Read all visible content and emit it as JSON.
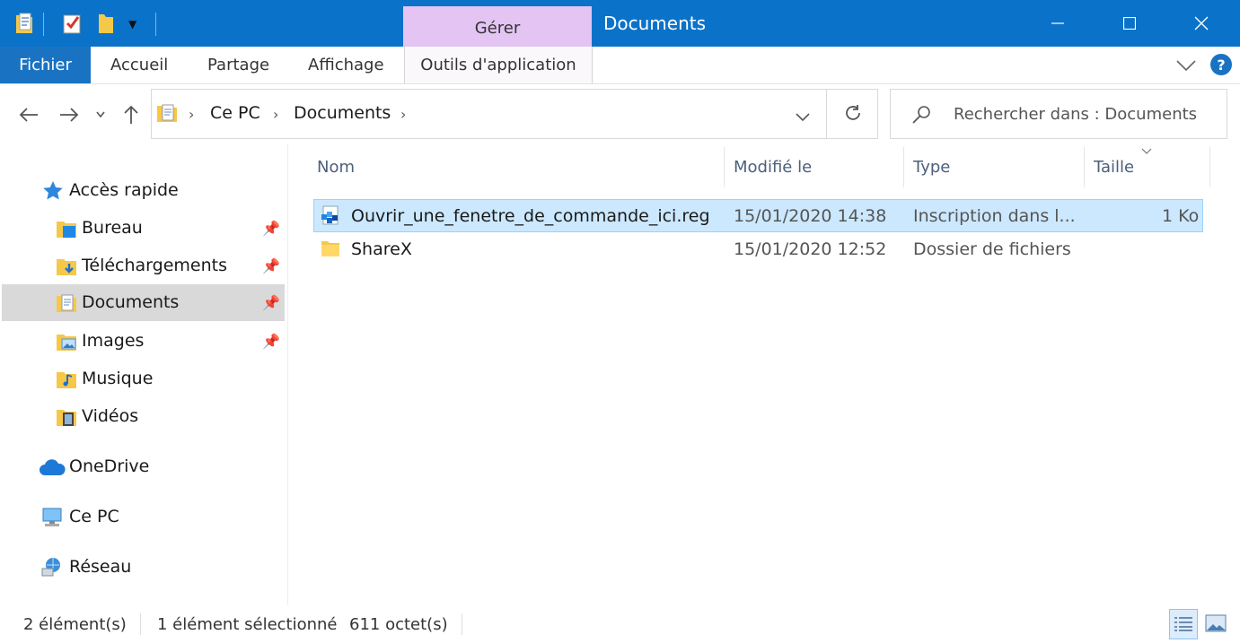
{
  "window": {
    "title": "Documents",
    "contextual_tab": "Gérer",
    "controls": {
      "minimize": "—",
      "maximize": "☐",
      "close": "✕"
    }
  },
  "ribbon": {
    "tabs": [
      "Fichier",
      "Accueil",
      "Partage",
      "Affichage",
      "Outils d'application"
    ],
    "help": "?"
  },
  "address": {
    "crumbs": [
      "Ce PC",
      "Documents"
    ]
  },
  "search": {
    "placeholder": "Rechercher dans : Documents"
  },
  "navpane": {
    "quick_access": "Accès rapide",
    "items": [
      "Bureau",
      "Téléchargements",
      "Documents",
      "Images",
      "Musique",
      "Vidéos"
    ],
    "onedrive": "OneDrive",
    "this_pc": "Ce PC",
    "network": "Réseau"
  },
  "filelist": {
    "columns": [
      "Nom",
      "Modifié le",
      "Type",
      "Taille"
    ],
    "rows": [
      {
        "name": "Ouvrir_une_fenetre_de_commande_ici.reg",
        "modified": "15/01/2020 14:38",
        "type": "Inscription dans l...",
        "size": "1 Ko"
      },
      {
        "name": "ShareX",
        "modified": "15/01/2020 12:52",
        "type": "Dossier de fichiers",
        "size": ""
      }
    ]
  },
  "status": {
    "count": "2 élément(s)",
    "selected": "1 élément sélectionné",
    "size": "611 octet(s)"
  },
  "colors": {
    "titlebar": "#0a72c9",
    "contextual": "#e3c4f2",
    "selection": "#cce8ff"
  }
}
